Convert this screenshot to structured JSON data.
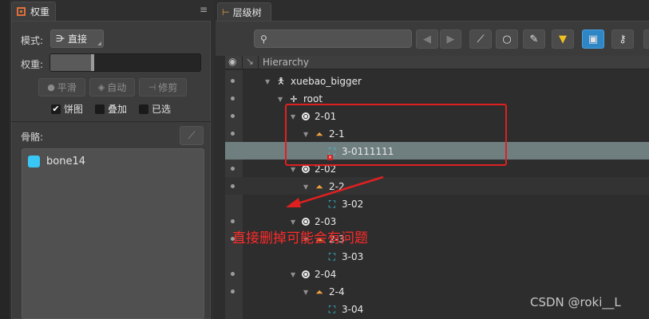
{
  "weight_panel": {
    "tab_label": "权重",
    "mode_label": "模式:",
    "mode_value": "直接",
    "weight_label": "权重:",
    "weight_fraction": 0.28,
    "buttons": {
      "smooth": "平滑",
      "auto": "自动",
      "prune": "修剪"
    },
    "checkboxes": {
      "pie": {
        "label": "饼图",
        "checked": true
      },
      "overlay": {
        "label": "叠加",
        "checked": false
      },
      "selected": {
        "label": "已选",
        "checked": false
      }
    },
    "bones_label": "骨骼:",
    "bones": [
      {
        "name": "bone14",
        "color": "#39c7f5"
      }
    ]
  },
  "hierarchy_panel": {
    "tab_label": "层级树",
    "header_title": "Hierarchy",
    "nodes": [
      {
        "label": "xuebao_bigger",
        "icon": "skeleton-icon"
      },
      {
        "label": "root",
        "icon": "root-bone-icon"
      },
      {
        "label": "2-01",
        "icon": "slot-icon"
      },
      {
        "label": "2-1",
        "icon": "attachment-hanger-icon"
      },
      {
        "label": "3-0111111",
        "icon": "mesh-error-icon"
      },
      {
        "label": "2-02",
        "icon": "slot-icon"
      },
      {
        "label": "2-2",
        "icon": "attachment-hanger-icon"
      },
      {
        "label": "3-02",
        "icon": "mesh-icon"
      },
      {
        "label": "2-03",
        "icon": "slot-icon"
      },
      {
        "label": "2-3",
        "icon": "attachment-hanger-icon"
      },
      {
        "label": "3-03",
        "icon": "mesh-icon"
      },
      {
        "label": "2-04",
        "icon": "slot-icon"
      },
      {
        "label": "2-4",
        "icon": "attachment-hanger-icon"
      },
      {
        "label": "3-04",
        "icon": "mesh-icon"
      }
    ]
  },
  "annotation": {
    "text": "直接删掉可能会有问题",
    "color": "#ff2a2a"
  },
  "watermark": "CSDN @roki__L",
  "colors": {
    "accent_blue": "#2f86c7",
    "selection": "#6f7f80",
    "bone_color": "#39c7f5",
    "annotation_red": "#e02020"
  }
}
